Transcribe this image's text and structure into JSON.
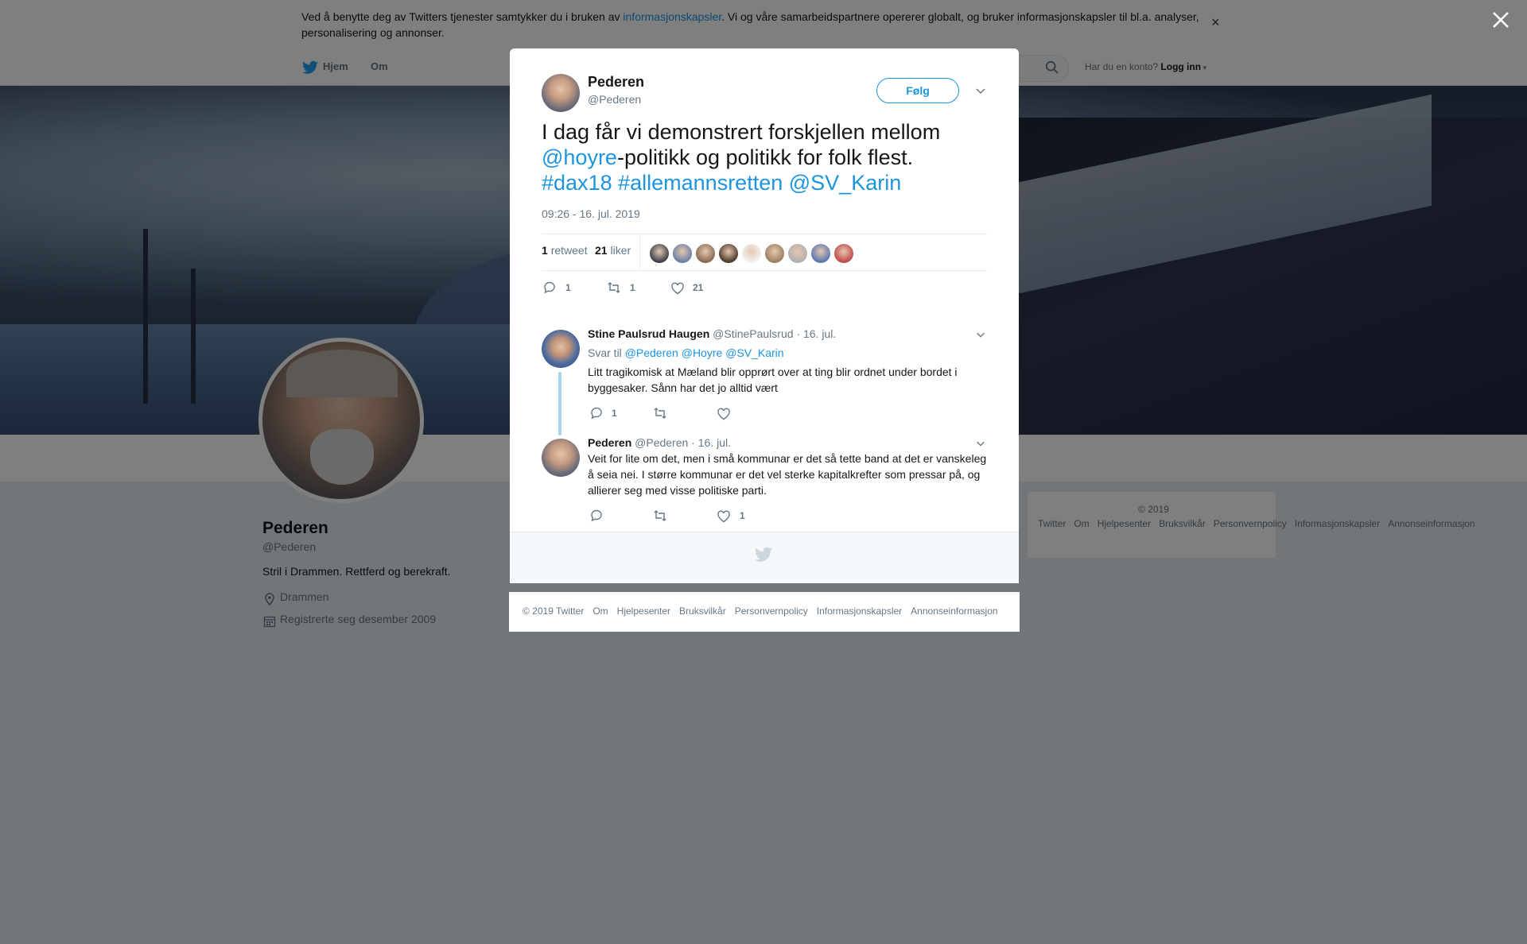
{
  "cookie_banner": {
    "text_before": "Ved å benytte deg av Twitters tjenester samtykker du i bruken av ",
    "link": "informasjonskapsler",
    "text_after": ". Vi og våre samarbeidspartnere opererer globalt, og bruker informasjonskapsler til bl.a. analyser, personalisering og annonser.",
    "close": "×"
  },
  "topnav": {
    "home": "Hjem",
    "about": "Om",
    "account_prompt": "Har du en konto?",
    "login": "Logg inn"
  },
  "profile": {
    "name": "Pederen",
    "handle": "@Pederen",
    "bio": "Stril i Drammen. Rettferd og berekraft.",
    "location": "Drammen",
    "joined": "Registrerte seg desember 2009"
  },
  "side_footer": [
    "© 2019 Twitter",
    "Om",
    "Hjelpesenter",
    "Bruksvilkår",
    "Personvernpolicy",
    "Informasjonskapsler",
    "Annonseinformasjon"
  ],
  "tweet": {
    "author_name": "Pederen",
    "author_handle": "@Pederen",
    "follow_label": "Følg",
    "text_1": "I dag får vi demonstrert forskjellen mellom ",
    "mention_1": "@hoyre",
    "text_2": "-politikk og politikk for folk flest. ",
    "hashtag_1": "#dax18",
    "hashtag_2": "#allemannsretten",
    "mention_2": "@SV_Karin",
    "timestamp": "09:26 - 16. jul. 2019",
    "retweet_count": "1",
    "retweet_label": "retweet",
    "like_count": "21",
    "like_label": "liker",
    "actions": {
      "reply": "1",
      "retweet": "1",
      "like": "21"
    }
  },
  "likers": [
    "#3a3f4a",
    "#6a7fa8",
    "#8a6a52",
    "#4a3a2a",
    "#f2f2f2",
    "#9a8060",
    "#b0b0b0",
    "#5a78b0",
    "#c04a4a"
  ],
  "replies": [
    {
      "name": "Stine Paulsrud Haugen",
      "handle": "@StinePaulsrud",
      "date": "· 16. jul.",
      "reply_to_label": "Svar til",
      "reply_to": [
        "@Pederen",
        "@Hoyre",
        "@SV_Karin"
      ],
      "text": "Litt tragikomisk at Mæland blir opprørt over at ting blir ordnet under bordet i byggesaker. Sånn har det jo alltid vært",
      "reply_count": "1",
      "like_count": ""
    },
    {
      "name": "Pederen",
      "handle": "@Pederen",
      "date": "· 16. jul.",
      "text": "Veit for lite om det, men i små kommunar er det så tette band at det er vanskeleg å seia nei. I større kommunar er det vel sterke kapitalkrefter som pressar på, og allierer seg med visse politiske parti.",
      "reply_count": "",
      "like_count": "1"
    }
  ],
  "bottom_footer": [
    "© 2019 Twitter",
    "Om",
    "Hjelpesenter",
    "Bruksvilkår",
    "Personvernpolicy",
    "Informasjonskapsler",
    "Annonseinformasjon"
  ],
  "colors": {
    "brand": "#1b95e0",
    "text": "#14171a",
    "muted": "#657786"
  }
}
